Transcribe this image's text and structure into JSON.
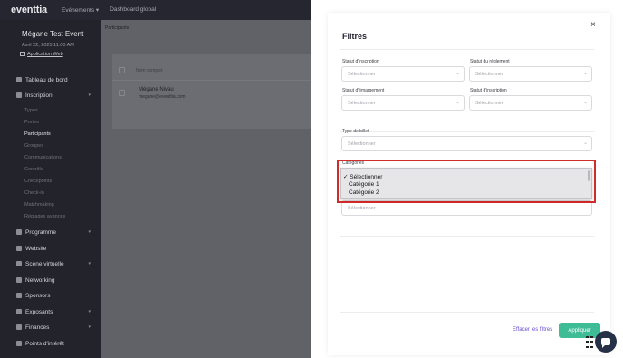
{
  "topbar": {
    "logo": "eventtia",
    "nav": [
      "Evénements ▾",
      "Dashboard global"
    ]
  },
  "event": {
    "name": "Mégane Test Event",
    "date": "Avril 22, 2025 11:00 AM",
    "app_link": "Application Web"
  },
  "sidebar": {
    "items": [
      {
        "label": "Tableau de bord",
        "chevron": ""
      },
      {
        "label": "Inscription",
        "chevron": "▾"
      },
      {
        "label": "Programme",
        "chevron": "▾"
      },
      {
        "label": "Website",
        "chevron": ""
      },
      {
        "label": "Scène virtuelle",
        "chevron": "▾"
      },
      {
        "label": "Networking",
        "chevron": ""
      },
      {
        "label": "Sponsors",
        "chevron": ""
      },
      {
        "label": "Exposants",
        "chevron": "▾"
      },
      {
        "label": "Finances",
        "chevron": "▾"
      },
      {
        "label": "Points d'intérêt",
        "chevron": ""
      }
    ],
    "subitems": [
      "Types",
      "Portes",
      "Participants",
      "Groupes",
      "Communications",
      "Contrôle",
      "Checkpoints",
      "Check-in",
      "Matchmaking",
      "Réglages avancés"
    ]
  },
  "background": {
    "breadcrumb": "Participants",
    "table_header": "Nom complet",
    "row_name": "Mégane Nivau",
    "row_email": "megane@eventtia.com"
  },
  "modal": {
    "title": "Filtres",
    "close": "×",
    "fields": {
      "statut_inscription": {
        "label": "Statut d'inscription",
        "placeholder": "Sélectionner"
      },
      "statut_reglement": {
        "label": "Statut du règlement",
        "placeholder": "Sélectionner"
      },
      "statut_emargement": {
        "label": "Statut d'émargement",
        "placeholder": "Sélectionner"
      },
      "statut_inscription_2": {
        "label": "Statut d'inscription",
        "placeholder": "Sélectionner"
      },
      "type_billet": {
        "label": "Type de billet",
        "placeholder": "Sélectionner"
      },
      "categories": {
        "label": "Categories",
        "placeholder": "Sélectionner"
      }
    },
    "dropdown_options": [
      "✓ Sélectionner",
      "Catégorie 1",
      "Catégorie 2"
    ],
    "clear_label": "Effacer les filtres",
    "apply_label": "Appliquer"
  },
  "colors": {
    "accent": "#3dbc96",
    "link": "#6a4fcf",
    "highlight": "#d32a2a",
    "sidebar": "#23242b"
  }
}
